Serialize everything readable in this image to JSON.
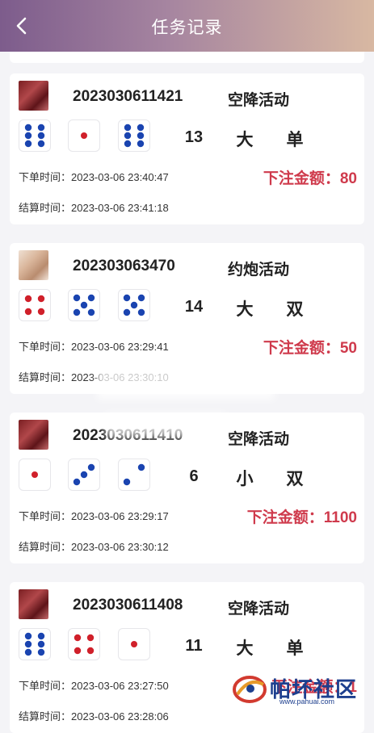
{
  "header": {
    "title": "任务记录",
    "back_icon": "chevron-left-icon"
  },
  "colors": {
    "accent_red": "#cf3a4c",
    "pip_blue": "#1a44b0",
    "pip_red": "#d0202a"
  },
  "records": [
    {
      "thumb": "red",
      "issue": "2023030611421",
      "event": "空降活动",
      "dice": [
        6,
        1,
        6
      ],
      "sum": "13",
      "size": "大",
      "parity": "单",
      "order_time": "下单时间：2023-03-06 23:40:47",
      "settle_time": "结算时间：2023-03-06 23:41:18",
      "bet": "下注金额：80"
    },
    {
      "thumb": "tan",
      "issue": "202303063470",
      "event": "约炮活动",
      "dice": [
        4,
        5,
        5
      ],
      "sum": "14",
      "size": "大",
      "parity": "双",
      "order_time": "下单时间：2023-03-06 23:29:41",
      "settle_time": "结算时间：2023-03-06 23:30:10",
      "bet": "下注金额：50"
    },
    {
      "thumb": "red",
      "issue": "2023030611410",
      "event": "空降活动",
      "dice": [
        1,
        3,
        2
      ],
      "sum": "6",
      "size": "小",
      "parity": "双",
      "order_time": "下单时间：2023-03-06 23:29:17",
      "settle_time": "结算时间：2023-03-06 23:30:12",
      "bet": "下注金额：1100"
    },
    {
      "thumb": "red",
      "issue": "2023030611408",
      "event": "空降活动",
      "dice": [
        6,
        4,
        1
      ],
      "sum": "11",
      "size": "大",
      "parity": "单",
      "order_time": "下单时间：2023-03-06 23:27:50",
      "settle_time": "结算时间：2023-03-06 23:28:06",
      "bet": "下注金额：1"
    }
  ],
  "watermark": {
    "text": "帕坏社区",
    "url": "www.pahuai.com"
  }
}
